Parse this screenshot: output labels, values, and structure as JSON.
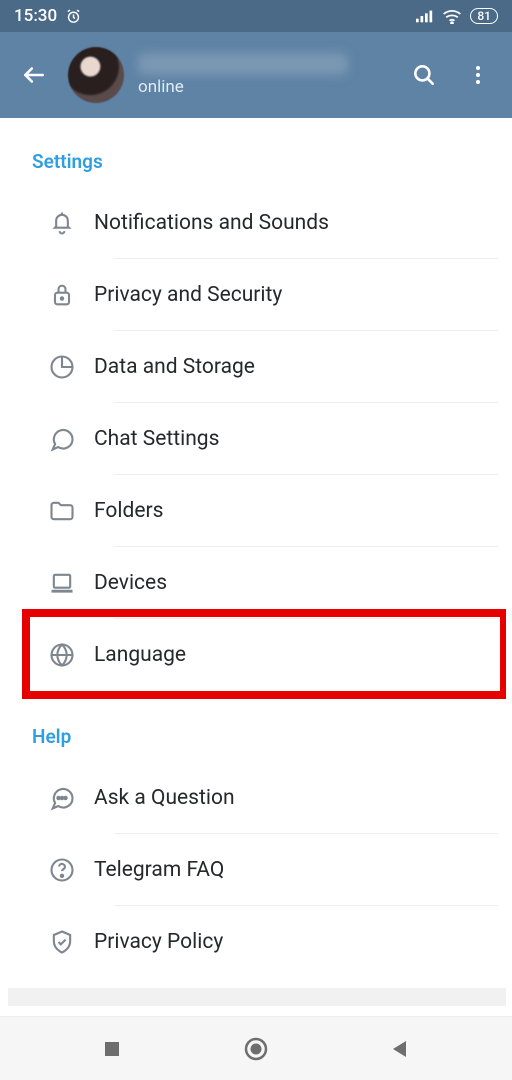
{
  "status": {
    "time": "15:30",
    "battery": "81"
  },
  "header": {
    "status_text": "online"
  },
  "sections": {
    "settings_title": "Settings",
    "help_title": "Help"
  },
  "settings_items": [
    {
      "label": "Notifications and Sounds"
    },
    {
      "label": "Privacy and Security"
    },
    {
      "label": "Data and Storage"
    },
    {
      "label": "Chat Settings"
    },
    {
      "label": "Folders"
    },
    {
      "label": "Devices"
    },
    {
      "label": "Language"
    }
  ],
  "help_items": [
    {
      "label": "Ask a Question"
    },
    {
      "label": "Telegram FAQ"
    },
    {
      "label": "Privacy Policy"
    }
  ],
  "highlight_index": 6
}
